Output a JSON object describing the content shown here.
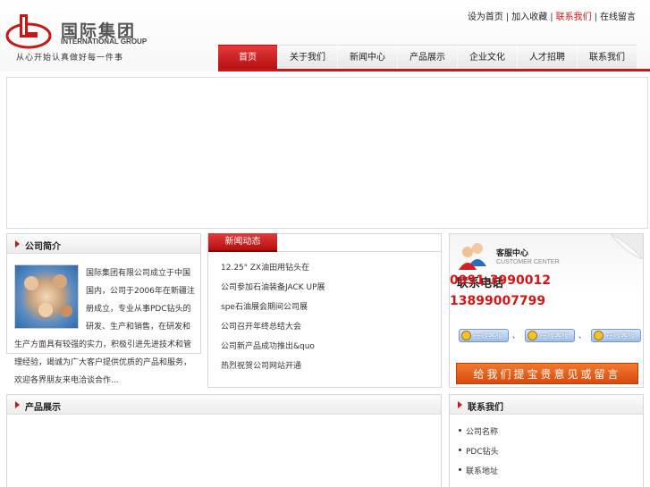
{
  "brand": {
    "name_cn": "国际集团",
    "name_en": "INTERNATIONAL GROUP",
    "slogan": "从心开始认真做好每一件事"
  },
  "toplinks": [
    {
      "label": "设为首页",
      "active": false
    },
    {
      "label": "加入收藏",
      "active": false
    },
    {
      "label": "联系我们",
      "active": true
    },
    {
      "label": "在线留言",
      "active": false
    }
  ],
  "nav": [
    {
      "label": "首页",
      "active": true
    },
    {
      "label": "关于我们",
      "active": false
    },
    {
      "label": "新闻中心",
      "active": false
    },
    {
      "label": "产品展示",
      "active": false
    },
    {
      "label": "企业文化",
      "active": false
    },
    {
      "label": "人才招聘",
      "active": false
    },
    {
      "label": "联系我们",
      "active": false
    }
  ],
  "about": {
    "title": "公司简介",
    "text": "国际集团有限公司成立于中国国内，公司于2006年在新疆注册成立，专业从事PDC钻头的研发、生产和销售，在研发和生产方面具有较强的实力，积极引进先进技术和管理经验，竭诚为广大客户提供优质的产品和服务，欢迎各界朋友来电洽谈合作..."
  },
  "news": {
    "tab": "新闻动态",
    "items": [
      "12.25\" ZX油田用钻头在",
      "公司参加石油装备JACK UP展",
      "spe石油展会期间公司展",
      "公司召开年终总结大会",
      "公司新产品成功推出&quo",
      "热烈祝贺公司网站开通"
    ]
  },
  "service": {
    "title": "客服中心",
    "subtitle": "CUSTOMER CENTER",
    "phone_label": "联系电话",
    "phone1": "0991-3990012",
    "phone2": "13899007799",
    "qq_label": "在线客服",
    "qq_count": 3,
    "feedback": "给我们提宝贵意见或留言"
  },
  "products": {
    "title": "产品展示"
  },
  "contact": {
    "title": "联系我们",
    "items": [
      "公司名称",
      "PDC钻头",
      "联系地址"
    ]
  },
  "colors": {
    "accent": "#c51818",
    "link_active": "#d41616",
    "feedback": "#e0581a"
  }
}
